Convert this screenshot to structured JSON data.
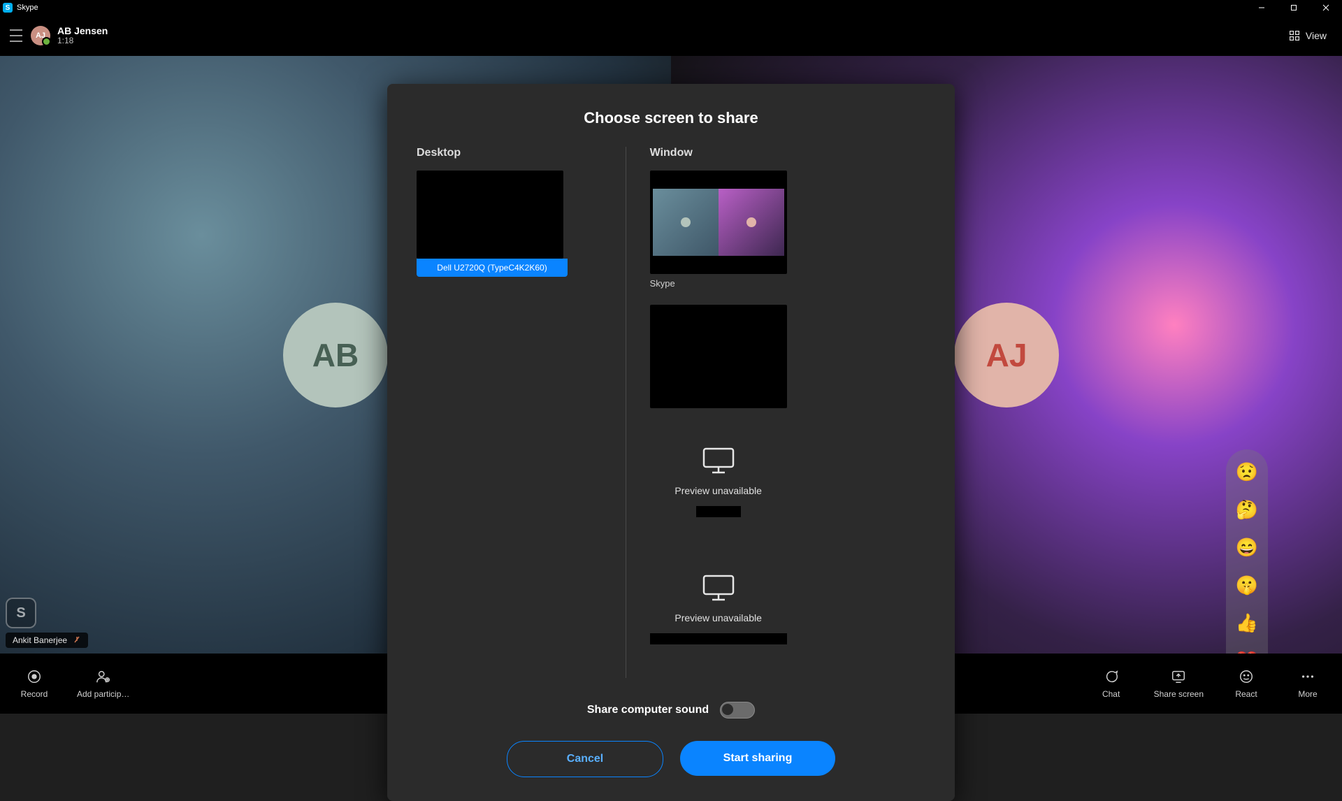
{
  "app": {
    "name": "Skype"
  },
  "header": {
    "caller_initials": "AJ",
    "caller_name": "AB Jensen",
    "duration": "1:18",
    "view_label": "View"
  },
  "video": {
    "left_initials": "AB",
    "right_initials": "AJ",
    "self_name": "Ankit Banerjee"
  },
  "controls": {
    "record": "Record",
    "add_participant": "Add particip…",
    "chat": "Chat",
    "share_screen": "Share screen",
    "react": "React",
    "more": "More"
  },
  "reactions": [
    "😟",
    "🤔",
    "😄",
    "🤫",
    "👍",
    "❤️"
  ],
  "share_dialog": {
    "title": "Choose screen to share",
    "desktop_heading": "Desktop",
    "window_heading": "Window",
    "desktop_item_label": "Dell U2720Q (TypeC4K2K60)",
    "window_item1_label": "Skype",
    "preview_unavailable": "Preview unavailable",
    "share_sound_label": "Share computer sound",
    "cancel": "Cancel",
    "start": "Start sharing"
  }
}
